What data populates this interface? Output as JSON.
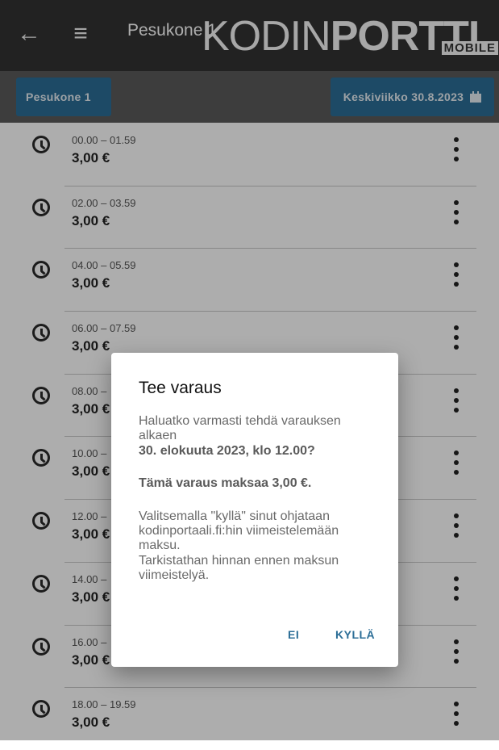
{
  "header": {
    "back_icon": "arrow-left-icon",
    "menu_icon": "hamburger-menu-icon",
    "title": "Pesukone 1",
    "logo": {
      "part1": "KODIN",
      "part2": "PORTTI",
      "badge": "MOBILE"
    }
  },
  "toolbar": {
    "machine_label": "Pesukone 1",
    "date_label": "Keskiviikko 30.8.2023",
    "date_icon": "calendar-icon"
  },
  "slots": [
    {
      "time": "00.00 – 01.59",
      "price": "3,00 €"
    },
    {
      "time": "02.00 – 03.59",
      "price": "3,00 €"
    },
    {
      "time": "04.00 – 05.59",
      "price": "3,00 €"
    },
    {
      "time": "06.00 – 07.59",
      "price": "3,00 €"
    },
    {
      "time": "08.00 –",
      "price": "3,00 €"
    },
    {
      "time": "10.00 –",
      "price": "3,00 €"
    },
    {
      "time": "12.00 –",
      "price": "3,00 €"
    },
    {
      "time": "14.00 –",
      "price": "3,00 €"
    },
    {
      "time": "16.00 –",
      "price": "3,00 €"
    },
    {
      "time": "18.00 – 19.59",
      "price": "3,00 €"
    }
  ],
  "dialog": {
    "title": "Tee varaus",
    "line1": "Haluatko varmasti tehdä varauksen alkaen",
    "line2": "30. elokuuta 2023, klo 12.00?",
    "cost": "Tämä varaus maksaa 3,00 €.",
    "info1": "Valitsemalla \"kyllä\" sinut ohjataan kodinportaali.fi:hin viimeistelemään maksu.",
    "info2": "Tarkistathan hinnan ennen maksun viimeistelyä.",
    "cancel_label": "EI",
    "confirm_label": "KYLLÄ"
  },
  "colors": {
    "appbar": "#333333",
    "toolbar": "#5a5a5a",
    "accent": "#2c6e97"
  }
}
